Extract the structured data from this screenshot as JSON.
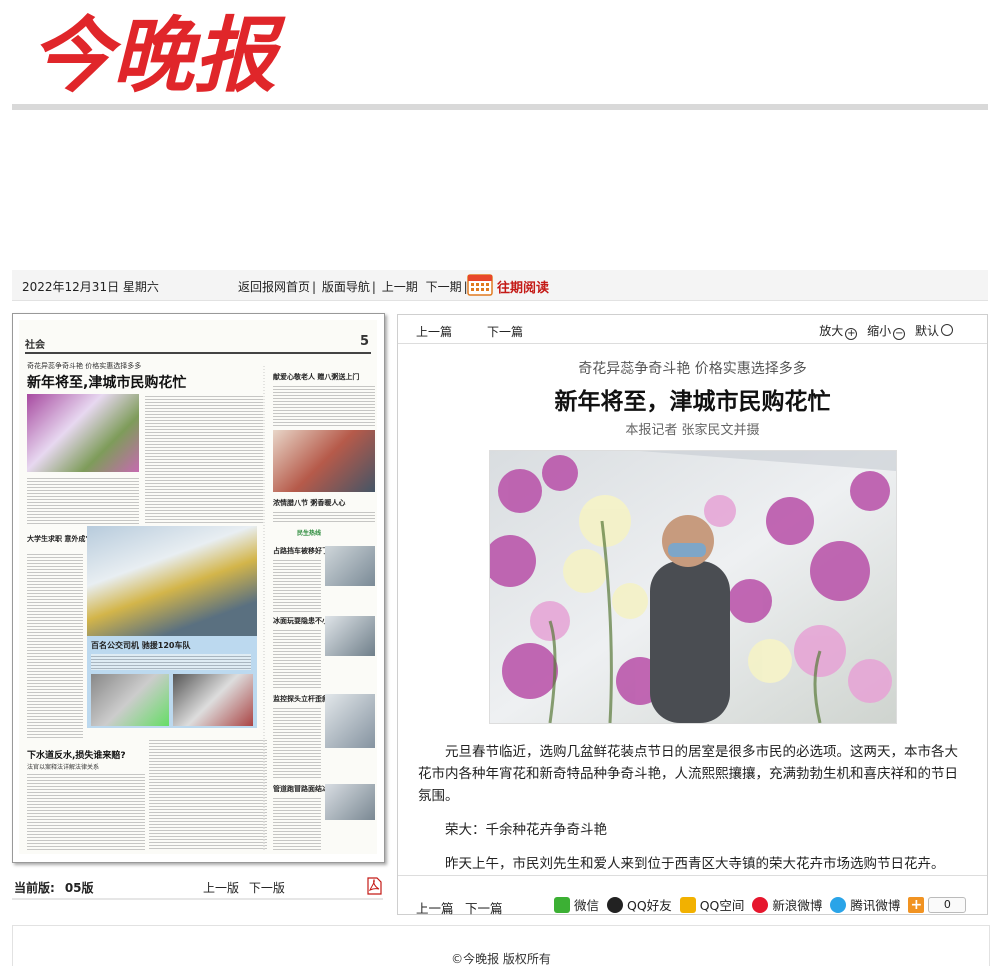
{
  "header": {
    "logo_text": "今晚报"
  },
  "navbar": {
    "date": "2022年12月31日 星期六",
    "links": [
      "返回报网首页",
      "版面导航",
      "上一期",
      "下一期"
    ],
    "past_reading": "往期阅读"
  },
  "page_image": {
    "section": "社会",
    "page_number": "5",
    "kicker": "奇花异蕊争奇斗艳 价格实惠选择多多",
    "headline": "新年将至,津城市民购花忙",
    "blue_caption": "百名公交司机 驰援120车队",
    "mid_title": "下水道反水,损失谁来赔?",
    "mid_sub": "法官以案释法详解法律关系",
    "right_head1": "献爱心敬老人 赠八粥送上门",
    "right_head2": "浓情腊八节 粥香暖人心",
    "right_head3": "占路挡车被移好了",
    "right_head4": "冰面玩耍隐患不小",
    "right_head5": "监控探头立杆歪斜",
    "right_head6": "管道跑冒路面结冰",
    "left_head": "大学生求职 意外成\"帮凶\"",
    "green_tag": "民生热线"
  },
  "below_page": {
    "current_label": "当前版:",
    "current_value": "05版",
    "prev": "上一版",
    "next": "下一版"
  },
  "article": {
    "top_prev": "上一篇",
    "top_next": "下一篇",
    "zoom_in": "放大",
    "zoom_out": "缩小",
    "default": "默认",
    "kicker": "奇花异蕊争奇斗艳 价格实惠选择多多",
    "title": "新年将至，津城市民购花忙",
    "byline": "本报记者 张家民文并摄",
    "paragraphs": [
      "元旦春节临近，选购几盆鲜花装点节日的居室是很多市民的必选项。这两天，本市各大花市内各种年宵花和新奇特品种争奇斗艳，人流熙熙攘攘，充满勃勃生机和喜庆祥和的节日氛围。",
      "荣大：千余种花卉争奇斗艳",
      "昨天上午，市民刘先生和爱人来到位于西青区大寺镇的荣大花卉市场选购节日花卉。"
    ],
    "bottom_prev": "上一篇",
    "bottom_next": "下一篇",
    "share": [
      "微信",
      "QQ好友",
      "QQ空间",
      "新浪微博",
      "腾讯微博"
    ],
    "share_count": "0"
  },
  "footer": {
    "copyright": "©今晚报 版权所有"
  },
  "colors": {
    "accent": "#c41a16",
    "logo": "#e0262a"
  }
}
